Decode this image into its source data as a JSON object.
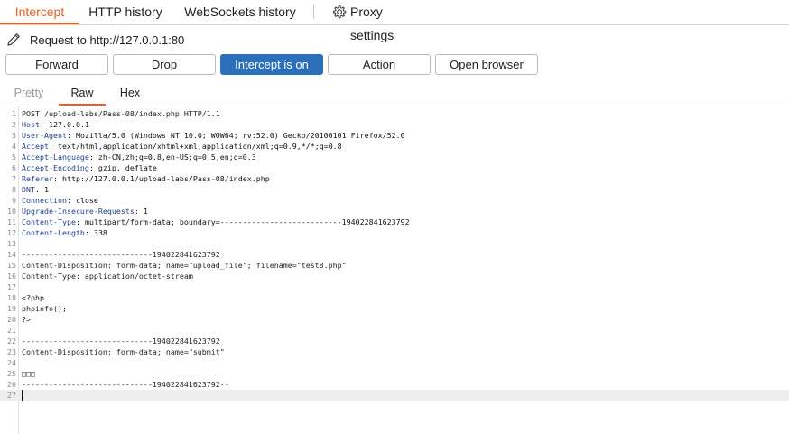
{
  "tabs": {
    "intercept": "Intercept",
    "http_history": "HTTP history",
    "websockets_history": "WebSockets history",
    "proxy_settings": "Proxy settings"
  },
  "request_label": "Request to http://127.0.0.1:80",
  "buttons": {
    "forward": "Forward",
    "drop": "Drop",
    "intercept_on": "Intercept is on",
    "action": "Action",
    "open_browser": "Open browser"
  },
  "editor_tabs": {
    "pretty": "Pretty",
    "raw": "Raw",
    "hex": "Hex"
  },
  "colors": {
    "accent": "#e8601c",
    "primary_button": "#2c6fba",
    "header_key": "#1d3f8a"
  },
  "icons": {
    "edit": "pencil-icon",
    "settings": "gear-icon"
  },
  "request_lines": [
    {
      "num": "1",
      "text": "POST /upload-labs/Pass-08/index.php HTTP/1.1"
    },
    {
      "num": "2",
      "key": "Host",
      "value": " 127.0.0.1"
    },
    {
      "num": "3",
      "key": "User-Agent",
      "value": " Mozilla/5.0 (Windows NT 10.0; WOW64; rv:52.0) Gecko/20100101 Firefox/52.0"
    },
    {
      "num": "4",
      "key": "Accept",
      "value": " text/html,application/xhtml+xml,application/xml;q=0.9,*/*;q=0.8"
    },
    {
      "num": "5",
      "key": "Accept-Language",
      "value": " zh-CN,zh;q=0.8,en-US;q=0.5,en;q=0.3"
    },
    {
      "num": "6",
      "key": "Accept-Encoding",
      "value": " gzip, deflate"
    },
    {
      "num": "7",
      "key": "Referer",
      "value": " http://127.0.0.1/upload-labs/Pass-08/index.php"
    },
    {
      "num": "8",
      "key": "DNT",
      "value": " 1"
    },
    {
      "num": "9",
      "key": "Connection",
      "value": " close"
    },
    {
      "num": "10",
      "key": "Upgrade-Insecure-Requests",
      "value": " 1"
    },
    {
      "num": "11",
      "key": "Content-Type",
      "value": " multipart/form-data; boundary=---------------------------194022841623792"
    },
    {
      "num": "12",
      "key": "Content-Length",
      "value": " 338"
    },
    {
      "num": "13",
      "text": ""
    },
    {
      "num": "14",
      "text": "-----------------------------194022841623792"
    },
    {
      "num": "15",
      "text": "Content-Disposition: form-data; name=\"upload_file\"; filename=\"test8.php\""
    },
    {
      "num": "16",
      "text": "Content-Type: application/octet-stream"
    },
    {
      "num": "17",
      "text": ""
    },
    {
      "num": "18",
      "text": "<?php"
    },
    {
      "num": "19",
      "text": "phpinfo();"
    },
    {
      "num": "20",
      "text": "?>"
    },
    {
      "num": "21",
      "text": ""
    },
    {
      "num": "22",
      "text": "-----------------------------194022841623792"
    },
    {
      "num": "23",
      "text": "Content-Disposition: form-data; name=\"submit\""
    },
    {
      "num": "24",
      "text": ""
    },
    {
      "num": "25",
      "text": "□□□"
    },
    {
      "num": "26",
      "text": "-----------------------------194022841623792--"
    },
    {
      "num": "27",
      "text": "",
      "current": true
    }
  ]
}
